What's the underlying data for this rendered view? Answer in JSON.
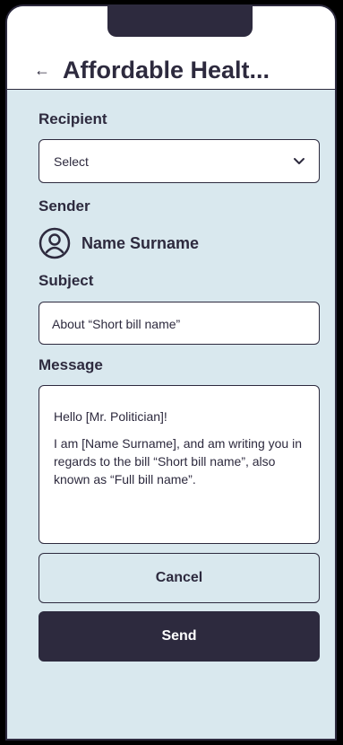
{
  "header": {
    "back_icon": "arrow-left-icon",
    "title": "Affordable Healt..."
  },
  "recipient": {
    "label": "Recipient",
    "selected": "Select",
    "icon": "chevron-down-icon"
  },
  "sender": {
    "label": "Sender",
    "avatar_icon": "user-circle-icon",
    "name": "Name Surname"
  },
  "subject": {
    "label": "Subject",
    "value": "About “Short bill name”"
  },
  "message": {
    "label": "Message",
    "paragraphs": [
      "Hello [Mr. Politician]!",
      "I am [Name Surname], and am writing you in regards to the bill “Short bill name”, also known as “Full bill name”."
    ]
  },
  "buttons": {
    "cancel": "Cancel",
    "send": "Send"
  },
  "colors": {
    "background": "#d9e8ee",
    "primary": "#2d2a3e",
    "header": "#ffffff"
  }
}
